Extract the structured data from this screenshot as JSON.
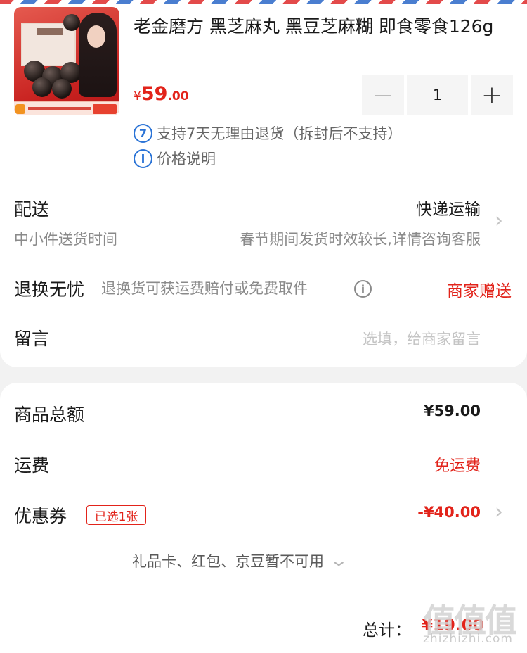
{
  "product": {
    "title": "老金磨方 黑芝麻丸 黑豆芝麻糊 即食零食126g",
    "price_symbol": "¥",
    "price_integer": "59",
    "price_decimal": ".00",
    "quantity": "1",
    "minus_label": "−",
    "plus_label": "+",
    "return_badge": "7",
    "return_note": "支持7天无理由退货（拆封后不支持）",
    "price_info_icon": "i",
    "price_info": "价格说明"
  },
  "delivery": {
    "label": "配送",
    "method": "快递运输",
    "sub_label": "中小件送货时间",
    "sub_value": "春节期间发货时效较长,详情咨询客服"
  },
  "return_worry_free": {
    "label": "退换无忧",
    "desc": "退换货可获运费赔付或免费取件",
    "info_icon": "i",
    "value": "商家赠送"
  },
  "message": {
    "label": "留言",
    "placeholder": "选填，给商家留言"
  },
  "summary": {
    "goods_total_label": "商品总额",
    "goods_total_value": "¥59.00",
    "shipping_label": "运费",
    "shipping_value": "免运费",
    "coupon_label": "优惠券",
    "coupon_badge": "已选1张",
    "coupon_value": "-¥40.00",
    "unavailable_note": "礼品卡、红包、京豆暂不可用",
    "total_label": "总计：",
    "total_value": "¥19.00"
  },
  "watermark": {
    "glyphs": "值值值",
    "url": "zhizhizhi.com"
  },
  "colors": {
    "accent_red": "#e2231a",
    "info_blue": "#2a73d6",
    "text_primary": "#1a1a1a",
    "text_secondary": "#8a8a8a",
    "page_bg": "#f2f2f2"
  },
  "icons": {
    "chevron_right": "chevron-right-icon",
    "chevron_down": "chevron-down-icon",
    "info": "info-icon",
    "return_7day": "seven-day-return-icon"
  }
}
